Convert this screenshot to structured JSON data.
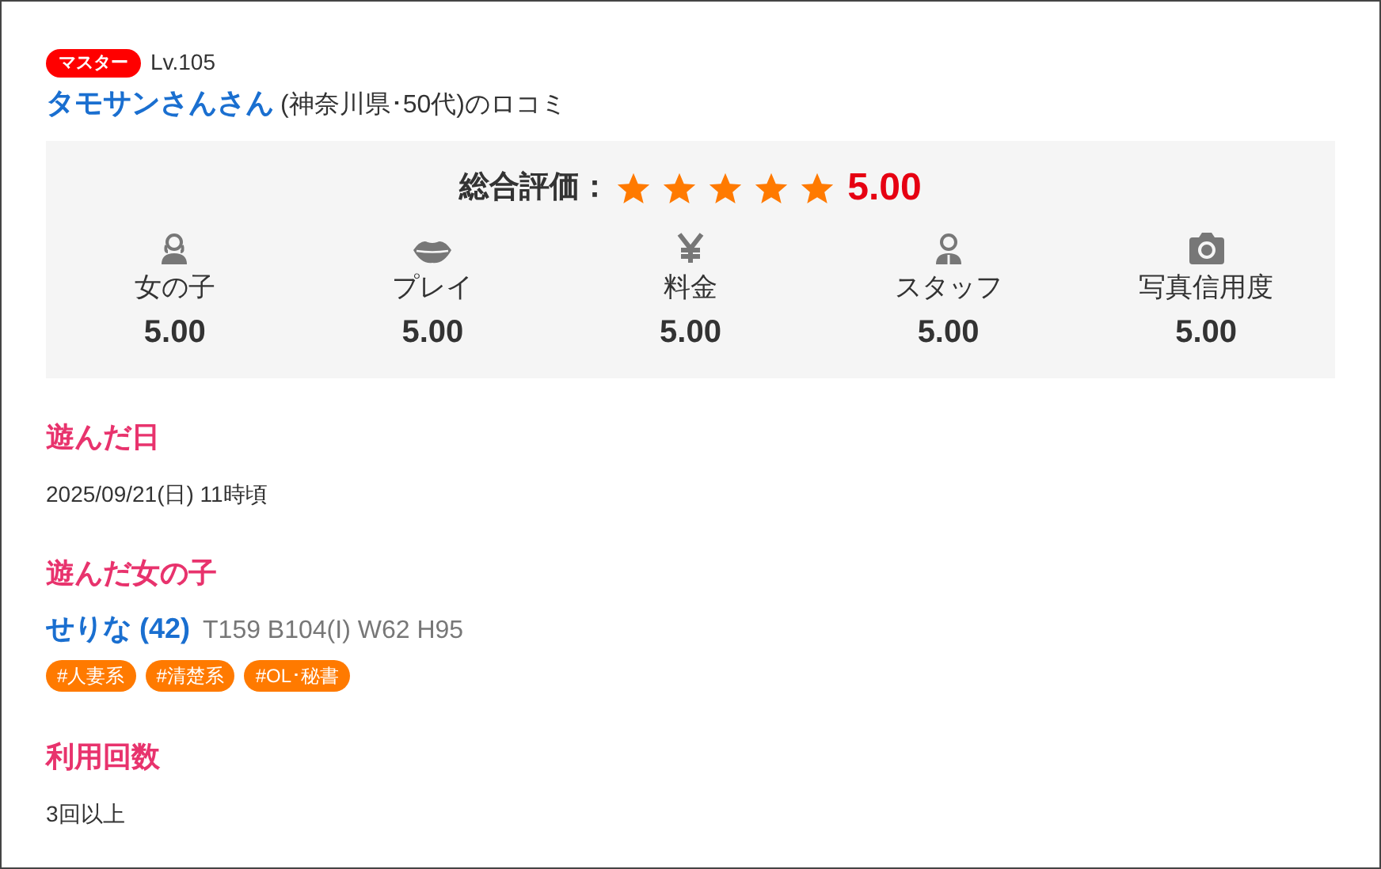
{
  "reviewer": {
    "badge": "マスター",
    "level": "Lv.105",
    "name": "タモサンさんさん",
    "meta": "(神奈川県･50代)のロコミ"
  },
  "overall": {
    "label": "総合評価：",
    "stars": 5,
    "score": "5.00"
  },
  "categories": [
    {
      "kind": "woman",
      "label": "女の子",
      "score": "5.00"
    },
    {
      "kind": "lips",
      "label": "プレイ",
      "score": "5.00"
    },
    {
      "kind": "yen",
      "label": "料金",
      "score": "5.00"
    },
    {
      "kind": "man",
      "label": "スタッフ",
      "score": "5.00"
    },
    {
      "kind": "camera",
      "label": "写真信用度",
      "score": "5.00"
    }
  ],
  "sections": [
    {
      "kind": "text",
      "heading": "遊んだ日",
      "text": "2025/09/21(日) 11時頃"
    },
    {
      "kind": "girl",
      "heading": "遊んだ女の子",
      "name": "せりな (42)",
      "specs": "T159 B104(I) W62 H95",
      "tags": [
        "#人妻系",
        "#清楚系",
        "#OL･秘書"
      ]
    },
    {
      "kind": "text",
      "heading": "利用回数",
      "text": "3回以上"
    }
  ]
}
